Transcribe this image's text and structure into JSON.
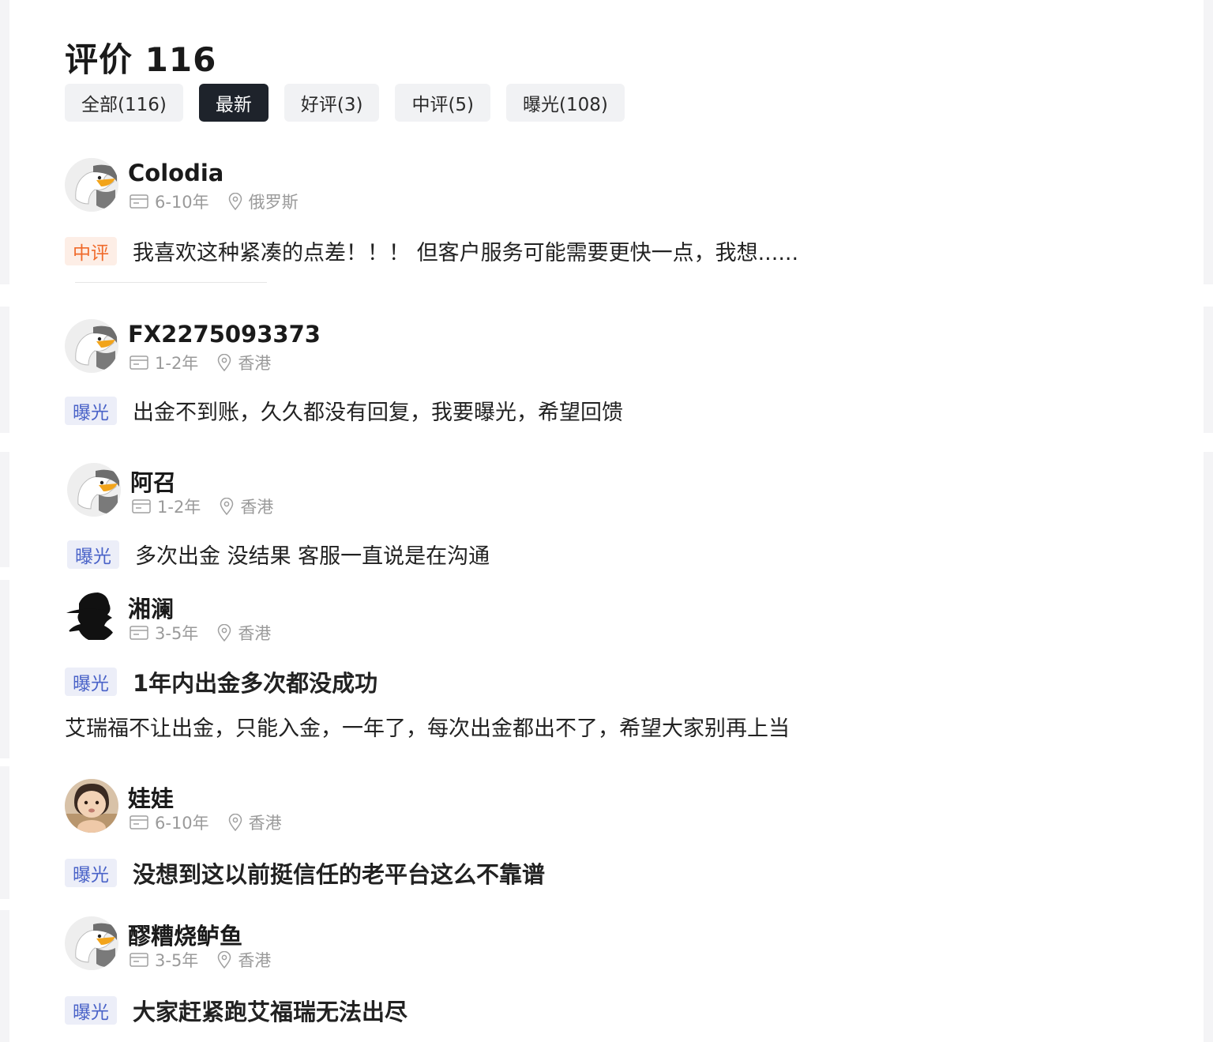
{
  "page": {
    "title": "评价 116"
  },
  "tabs": [
    {
      "label": "全部(116)",
      "active": false
    },
    {
      "label": "最新",
      "active": true
    },
    {
      "label": "好评(3)",
      "active": false
    },
    {
      "label": "中评(5)",
      "active": false
    },
    {
      "label": "曝光(108)",
      "active": false
    }
  ],
  "reviews": [
    {
      "name": "Colodia",
      "years": "6-10年",
      "location": "俄罗斯",
      "badge": "中评",
      "text": "我喜欢这种紧凑的点差！！！ 但客户服务可能需要更快一点，我想......",
      "avatar": "eagle-avatar"
    },
    {
      "name": "FX2275093373",
      "years": "1-2年",
      "location": "香港",
      "badge": "曝光",
      "text": "出金不到账，久久都没有回复，我要曝光，希望回馈",
      "avatar": "eagle-avatar"
    },
    {
      "name": "阿召",
      "years": "1-2年",
      "location": "香港",
      "badge": "曝光",
      "text": "多次出金 没结果 客服一直说是在沟通",
      "avatar": "eagle-avatar"
    },
    {
      "name": "湘澜",
      "years": "3-5年",
      "location": "香港",
      "badge": "曝光",
      "title": "1年内出金多次都没成功",
      "text": "艾瑞福不让出金，只能入金，一年了，每次出金都出不了，希望大家别再上当",
      "avatar": "silhouette-avatar"
    },
    {
      "name": "娃娃",
      "years": "6-10年",
      "location": "香港",
      "badge": "曝光",
      "text": "没想到这以前挺信任的老平台这么不靠谱",
      "avatar": "baby-photo-avatar"
    },
    {
      "name": "醪糟烧鲈鱼",
      "years": "3-5年",
      "location": "香港",
      "badge": "曝光",
      "text": "大家赶紧跑艾福瑞无法出尽",
      "avatar": "eagle-avatar"
    }
  ],
  "icons": {
    "years": "id-card-icon",
    "location": "location-pin-icon"
  },
  "colors": {
    "mid_badge_bg": "#fdeee6",
    "mid_badge_text": "#f06a2a",
    "exp_badge_bg": "#eceef8",
    "exp_badge_text": "#4a63c8",
    "active_tab": "#1e232b"
  }
}
